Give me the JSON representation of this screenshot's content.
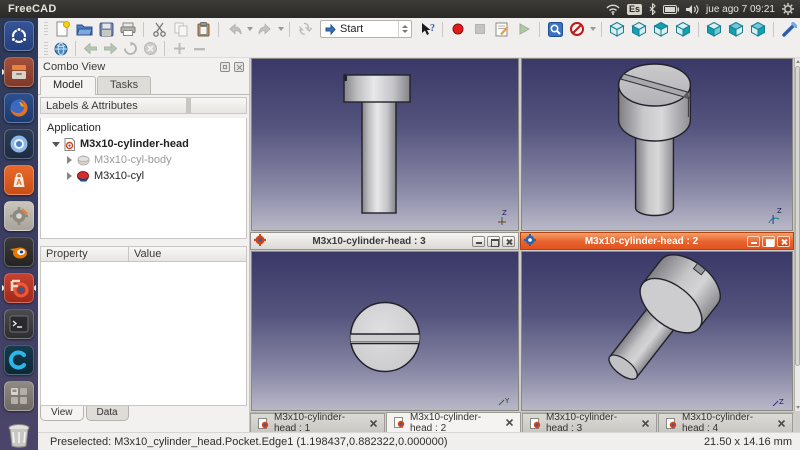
{
  "titlebar": {
    "title": "FreeCAD",
    "keyboard": "Es",
    "clock": "jue ago 7 09:21"
  },
  "launcher": {
    "items": [
      "ubuntu-dash",
      "file-manager",
      "firefox",
      "chromium",
      "software-center",
      "system-settings",
      "blender",
      "freecad",
      "terminal",
      "c-application",
      "workspace-switcher",
      "trash"
    ]
  },
  "toolbar": {
    "workbench": "Start",
    "icons_row1": [
      "new-document",
      "open-document",
      "save-document",
      "print",
      "cut",
      "copy",
      "paste",
      "undo",
      "redo",
      "refresh",
      "workbench-selector",
      "whats-this",
      "macro-record",
      "macro-stop",
      "macro-edit",
      "macro-play",
      "fit-all",
      "draw-style",
      "view-axonometric",
      "view-front",
      "view-top",
      "view-right",
      "view-rear",
      "view-bottom",
      "view-left",
      "measure"
    ],
    "icons_row2": [
      "web-browser",
      "nav-back",
      "nav-forward",
      "nav-refresh",
      "nav-stop",
      "zoom-in",
      "zoom-out"
    ]
  },
  "combo_view": {
    "title": "Combo View",
    "tabs": {
      "model": "Model",
      "tasks": "Tasks"
    },
    "header": "Labels & Attributes",
    "tree": {
      "root": "Application",
      "document": "M3x10-cylinder-head",
      "body": "M3x10-cyl-body",
      "part": "M3x10-cyl"
    },
    "properties": {
      "col1": "Property",
      "col2": "Value"
    },
    "bottom_tabs": {
      "view": "View",
      "data": "Data"
    }
  },
  "mdi": {
    "window3": "M3x10-cylinder-head : 3",
    "window2": "M3x10-cylinder-head : 2",
    "tabs": [
      "M3x10-cylinder-head : 1",
      "M3x10-cylinder-head : 2",
      "M3x10-cylinder-head : 3",
      "M3x10-cylinder-head : 4"
    ]
  },
  "statusbar": {
    "message": "Preselected: M3x10_cylinder_head.Pocket.Edge1 (1.198437,0.882322,0.000000)",
    "dimensions": "21.50 x 14.16 mm"
  },
  "colors": {
    "ubuntu_orange": "#e95420",
    "active_title": "#e8622d",
    "viewport_top": "#393867",
    "viewport_bottom": "#b9b8c8"
  }
}
